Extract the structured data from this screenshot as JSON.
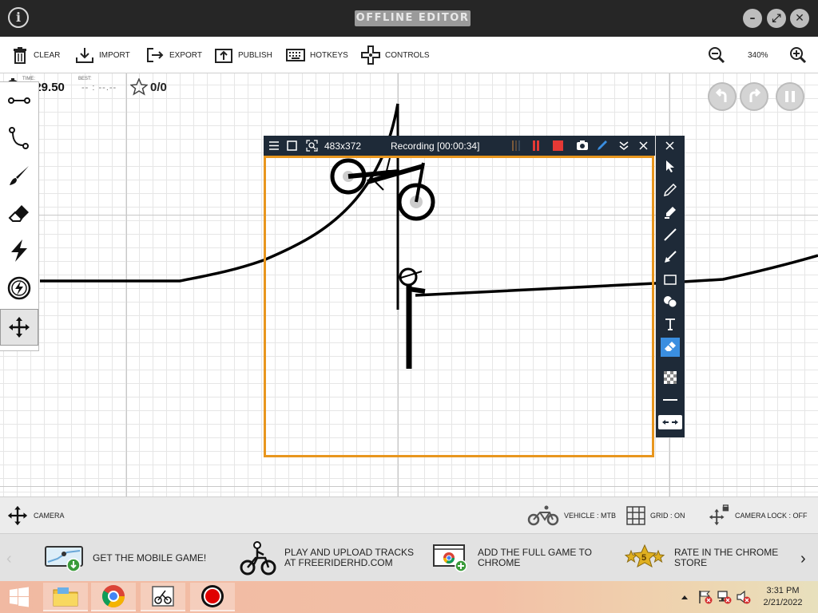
{
  "titlebar": {
    "title": "OFFLINE EDITOR",
    "info_glyph": "i",
    "minimize_glyph": "–",
    "maximize_glyph": "⤢",
    "close_glyph": "✕"
  },
  "toolbar": {
    "items": [
      {
        "label": "CLEAR",
        "icon": "trash-icon"
      },
      {
        "label": "IMPORT",
        "icon": "download-icon"
      },
      {
        "label": "EXPORT",
        "icon": "export-icon"
      },
      {
        "label": "PUBLISH",
        "icon": "upload-icon"
      },
      {
        "label": "HOTKEYS",
        "icon": "keyboard-icon"
      },
      {
        "label": "CONTROLS",
        "icon": "dpad-icon"
      }
    ],
    "zoom": "340%"
  },
  "hud": {
    "time_label": "TIME:",
    "time": "0:29.50",
    "best_label": "BEST:",
    "best": "-- : --.--",
    "stars": "0/0"
  },
  "palette": [
    "straight-line-icon",
    "curve-icon",
    "brush-icon",
    "eraser-icon",
    "boost-icon",
    "gravity-icon",
    "move-icon"
  ],
  "recorder": {
    "size": "483x372",
    "status": "Recording [00:00:34]"
  },
  "statusbar": {
    "camera": "CAMERA",
    "vehicle": "VEHICLE : MTB",
    "grid": "GRID : ON",
    "camera_lock": "CAMERA LOCK : OFF"
  },
  "promo": {
    "items": [
      {
        "line1": "GET THE MOBILE GAME!",
        "line2": ""
      },
      {
        "line1": "PLAY AND UPLOAD TRACKS",
        "line2": "AT FREERIDERHD.COM"
      },
      {
        "line1": "ADD THE FULL GAME TO",
        "line2": "CHROME"
      },
      {
        "line1": "RATE IN THE CHROME",
        "line2": "STORE"
      }
    ],
    "badge": "5"
  },
  "taskbar": {
    "time": "3:31 PM",
    "date": "2/21/2022"
  },
  "colors": {
    "titlebar": "#262626",
    "recording_frame": "#e8961e",
    "recorder_panel": "#1e2a38",
    "accent": "#3a8ee0"
  }
}
